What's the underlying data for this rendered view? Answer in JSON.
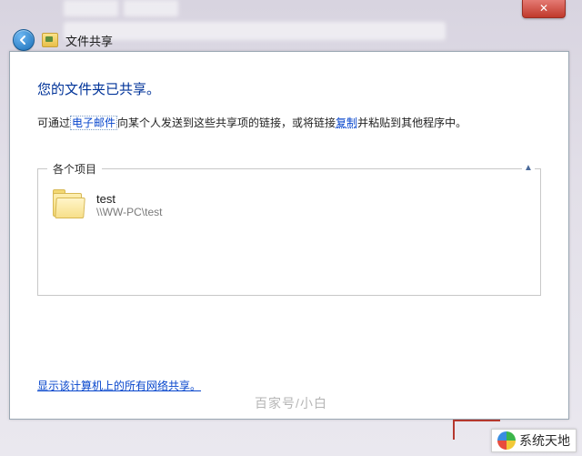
{
  "window": {
    "close_glyph": "✕",
    "title": "文件共享"
  },
  "heading": "您的文件夹已共享。",
  "instruction": {
    "prefix": "可通过",
    "email_link": "电子邮件",
    "mid": "向某个人发送到这些共享项的链接，或将链接",
    "copy_link": "复制",
    "suffix": "并粘贴到其他程序中。"
  },
  "group": {
    "label": "各个项目",
    "collapse_glyph": "▲"
  },
  "item": {
    "name": "test",
    "path": "\\\\WW-PC\\test"
  },
  "bottom_link": "显示该计算机上的所有网络共享。",
  "watermark1": "百家号/小白",
  "watermark2": "系统天地"
}
